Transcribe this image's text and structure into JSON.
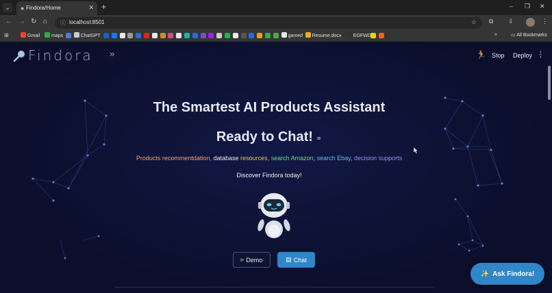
{
  "browser": {
    "tab_title": "Findora/Home",
    "url": "localhost:8501",
    "window_controls": [
      "–",
      "❐",
      "✕"
    ],
    "bookmarks": [
      {
        "label": "Gmail",
        "color": "#ea4335"
      },
      {
        "label": "maps",
        "color": "#34a853"
      },
      {
        "label": "",
        "color": "#4a7dd6"
      },
      {
        "label": "ChatGPT",
        "color": "#cccccc"
      },
      {
        "label": "",
        "color": "#0a66c2"
      },
      {
        "label": "",
        "color": "#1877f2"
      },
      {
        "label": "",
        "color": "#e8e8e8"
      },
      {
        "label": "",
        "color": "#999999"
      },
      {
        "label": "",
        "color": "#2a6ad6"
      },
      {
        "label": "",
        "color": "#e62117"
      },
      {
        "label": "",
        "color": "#e8e8e8"
      },
      {
        "label": "",
        "color": "#c98a3a"
      },
      {
        "label": "",
        "color": "#d04a8a"
      },
      {
        "label": "",
        "color": "#e8e8e8"
      },
      {
        "label": "",
        "color": "#1fb2a6"
      },
      {
        "label": "",
        "color": "#2a6ad6"
      },
      {
        "label": "",
        "color": "#7a4ad6"
      },
      {
        "label": "",
        "color": "#a020f0"
      },
      {
        "label": "",
        "color": "#cccccc"
      },
      {
        "label": "",
        "color": "#1fb24a"
      },
      {
        "label": "",
        "color": "#e8e8e8"
      },
      {
        "label": "",
        "color": "#555555"
      },
      {
        "label": "",
        "color": "#2a6ad6"
      },
      {
        "label": "",
        "color": "#e8a020"
      },
      {
        "label": "",
        "color": "#3aa84a"
      },
      {
        "label": "",
        "color": "#4aa84a"
      },
      {
        "label": "gamed",
        "color": "#e8e8e8"
      },
      {
        "label": "Resume.docx",
        "color": "#e8b020"
      },
      {
        "label": "EGFWD",
        "color": "#333333"
      },
      {
        "label": "",
        "color": "#e8d020"
      },
      {
        "label": "",
        "color": "#e86a20"
      }
    ],
    "all_bookmarks": "All Bookmarks",
    "more_bookmarks": "»"
  },
  "app": {
    "logo_text": "Findora",
    "collapse": "»",
    "stop": "Stop",
    "deploy": "Deploy",
    "menu": "⋮",
    "title": "The Smartest AI Products Assistant",
    "subtitle": "Ready to Chat!",
    "link_icon": "⚭",
    "features": {
      "f1": "Products recommentdation,",
      "f2": "database",
      "f3": "resources,",
      "f4": "search Amazon,",
      "f5": "search Ebay,",
      "f6": "decision supports"
    },
    "discover": "Discover Findora today!",
    "demo_icon": "▹",
    "demo": "Demo",
    "chat_icon": "▤",
    "chat": "Chat",
    "ask_icon": "✨",
    "ask": "Ask Findora!"
  },
  "colors": {
    "background": "#0d1130",
    "accent": "#2f86c8"
  }
}
